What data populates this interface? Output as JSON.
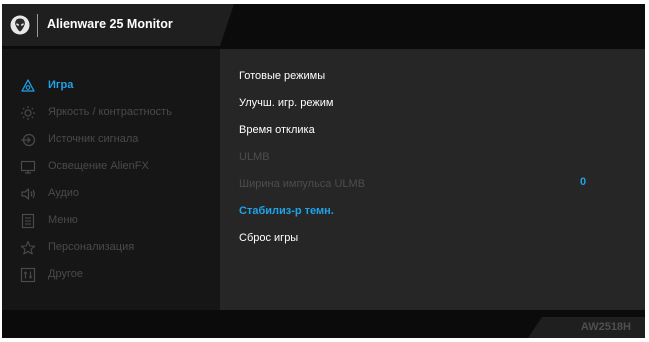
{
  "header": {
    "title": "Alienware 25 Monitor",
    "logo_icon": "alien-head-icon"
  },
  "menu": {
    "items": [
      {
        "label": "Игра",
        "icon": "gamepad-icon",
        "active": true
      },
      {
        "label": "Яркость / контрастность",
        "icon": "brightness-icon",
        "active": false
      },
      {
        "label": "Источник сигнала",
        "icon": "input-source-icon",
        "active": false
      },
      {
        "label": "Освещение AlienFX",
        "icon": "monitor-icon",
        "active": false
      },
      {
        "label": "Аудио",
        "icon": "speaker-icon",
        "active": false
      },
      {
        "label": "Меню",
        "icon": "menu-icon",
        "active": false
      },
      {
        "label": "Персонализация",
        "icon": "star-icon",
        "active": false
      },
      {
        "label": "Другое",
        "icon": "other-icon",
        "active": false
      }
    ]
  },
  "submenu": {
    "items": [
      {
        "label": "Готовые режимы",
        "state": "normal"
      },
      {
        "label": "Улучш. игр. режим",
        "state": "normal"
      },
      {
        "label": "Время отклика",
        "state": "normal"
      },
      {
        "label": "ULMB",
        "state": "disabled"
      },
      {
        "label": "Ширина импульса ULMB",
        "state": "disabled"
      },
      {
        "label": "Стабилиз-р темн.",
        "state": "selected"
      },
      {
        "label": "Сброс игры",
        "state": "normal"
      }
    ]
  },
  "value_panel": {
    "value": "0"
  },
  "footer": {
    "model": "AW2518H"
  },
  "colors": {
    "accent": "#1ea3e8",
    "background": "#0b0b0b",
    "panel": "#262626",
    "left_panel": "#161616",
    "disabled_text": "#4d4d4d"
  }
}
